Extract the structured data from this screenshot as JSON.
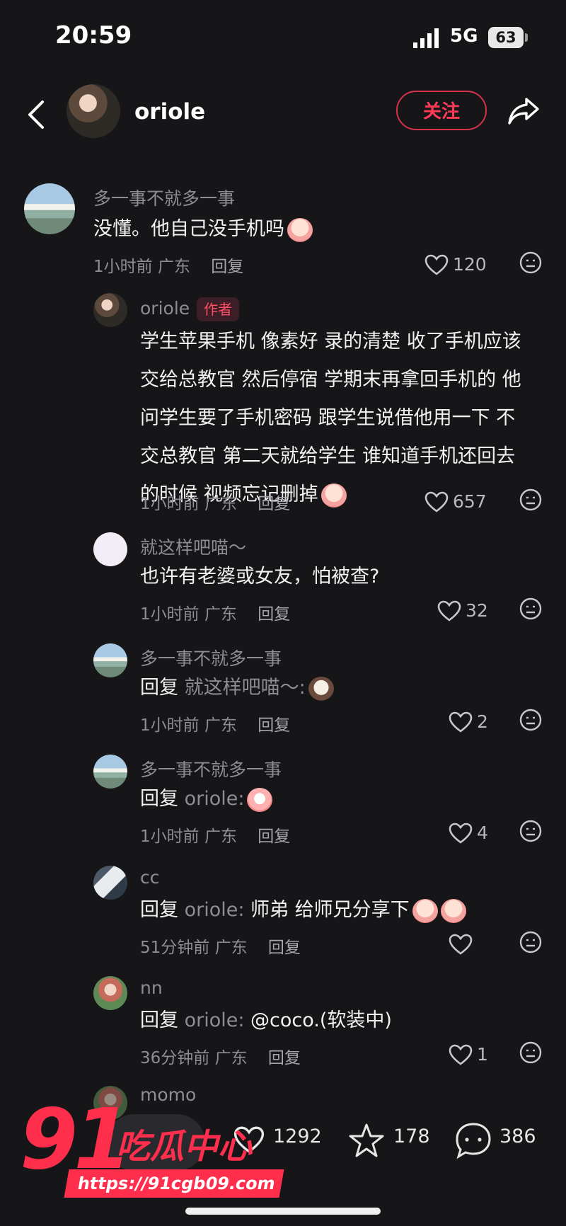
{
  "status_bar": {
    "time": "20:59",
    "network": "5G",
    "battery": "63"
  },
  "header": {
    "username": "oriole",
    "follow_label": "关注"
  },
  "comments": [
    {
      "name": "多一事不就多一事",
      "text": "没懂。他自己没手机吗",
      "time": "1小时前",
      "location": "广东",
      "reply_label": "回复",
      "likes": "120"
    },
    {
      "name": "oriole",
      "badge": "作者",
      "text_lines": [
        "学生苹果手机 像素好 录的清楚 收了手机应该",
        "交给总教官 然后停宿 学期末再拿回手机的 他",
        "问学生要了手机密码 跟学生说借他用一下 不",
        "交总教官 第二天就给学生 谁知道手机还回去",
        "的时候 视频忘记删掉"
      ],
      "time": "1小时前",
      "location": "广东",
      "reply_label": "回复",
      "likes": "657"
    },
    {
      "name": "就这样吧喵～",
      "text": "也许有老婆或女友，怕被查?",
      "time": "1小时前",
      "location": "广东",
      "reply_label": "回复",
      "likes": "32"
    },
    {
      "name": "多一事不就多一事",
      "reply_prefix": "回复",
      "reply_target": "就这样吧喵～:",
      "text": "",
      "time": "1小时前",
      "location": "广东",
      "reply_label": "回复",
      "likes": "2"
    },
    {
      "name": "多一事不就多一事",
      "reply_prefix": "回复",
      "reply_target": "oriole:",
      "text": "",
      "time": "1小时前",
      "location": "广东",
      "reply_label": "回复",
      "likes": "4"
    },
    {
      "name": "cc",
      "reply_prefix": "回复",
      "reply_target": "oriole:",
      "text": "师弟 给师兄分享下",
      "time": "51分钟前",
      "location": "广东",
      "reply_label": "回复",
      "likes": ""
    },
    {
      "name": "nn",
      "reply_prefix": "回复",
      "reply_target": "oriole:",
      "text": "@coco.(软装中)",
      "time": "36分钟前",
      "location": "广东",
      "reply_label": "回复",
      "likes": "1"
    },
    {
      "name": "momo"
    }
  ],
  "bottom_bar": {
    "likes": "1292",
    "favorites": "178",
    "comments": "386"
  },
  "watermark": {
    "number": "91",
    "text": "吃瓜中心",
    "url": "https://91cgb09.com"
  }
}
